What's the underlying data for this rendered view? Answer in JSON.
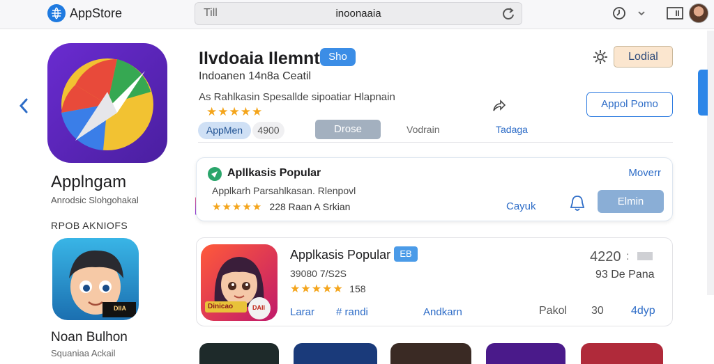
{
  "topbar": {
    "brand": "AppStore",
    "address_left": "Till",
    "address_url": "inoonaaia"
  },
  "sidebar": {
    "app_name": "Applngam",
    "app_sub": "Anrodsic Slohgohakal",
    "section_label": "RPOB AKNIOFS",
    "featured_name": "Noan Bulhon",
    "featured_sub": "Squaniaa Ackail",
    "boy_badge": "DIIA"
  },
  "hero": {
    "title": "Ilvdoaia Ilemnt",
    "badge": "Sho",
    "subtitle": "Indoanen 14n8a Ceatil",
    "description": "As Rahlkasin Spesallde sipoatiar Hlapnain",
    "rating_stars": "★★★★★",
    "pill_active": "AppMen",
    "pill_count": "4900",
    "tab_primary": "Drose",
    "tab_links": [
      "Vodrain",
      "Tadaga"
    ],
    "top_button": "Lodial",
    "outline_button": "Appol Pomo"
  },
  "popular_card": {
    "title": "Apllkasis Popular",
    "more": "Moverr",
    "desc": "Applkarh Parsahlkasan. Rlenpovl",
    "stars": "★★★★★",
    "meta": "228 Raan A Srkian",
    "link": "Cayuk",
    "button": "Elmin"
  },
  "app_card": {
    "title": "Applkasis Popular",
    "tag": "EB",
    "line2": "39080 7/S2S",
    "stars": "★★★★★",
    "count": "158",
    "links": [
      "Larar",
      "# randi",
      "Andkarn"
    ],
    "price": "4220",
    "dots": ":",
    "rating_text": "93 De  Pana",
    "bottom_left": "Pakol",
    "bottom_mid": "30",
    "bottom_right": "4dyp",
    "girl_label": "Dinicao",
    "girl_badge": "DAII"
  },
  "colors": {
    "accent": "#2d6cc7",
    "star": "#f4a51c",
    "peach_button": "#fbe6cf",
    "scroll_tab": "#2d86e8"
  },
  "icons": [
    "globe-logo-icon",
    "reload-icon",
    "history-icon",
    "chevron-down-icon",
    "window-icon",
    "avatar",
    "back-chevron-icon",
    "gear-icon",
    "share-icon",
    "bell-icon",
    "check-badge-icon"
  ]
}
